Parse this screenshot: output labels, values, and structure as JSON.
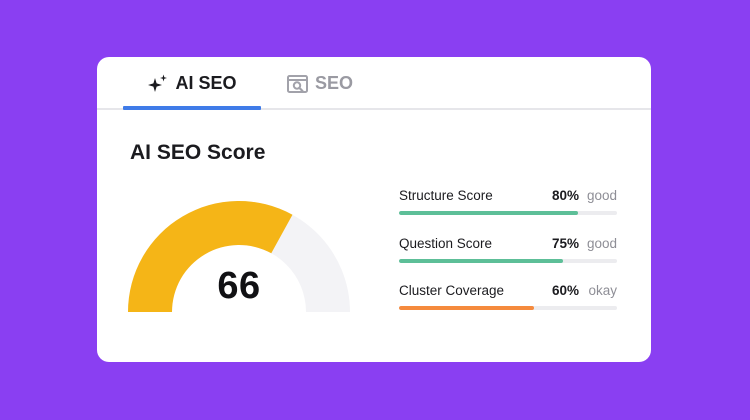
{
  "tabs": [
    {
      "label": "AI SEO",
      "icon": "sparkle-icon",
      "active": true,
      "accent": "#3f7be8"
    },
    {
      "label": "SEO",
      "icon": "seo-search-icon",
      "active": false
    }
  ],
  "main": {
    "title": "AI SEO Score",
    "gauge": {
      "value": "66",
      "fraction": 0.66,
      "fill_color": "#f5b517",
      "track_color": "#f3f3f6"
    },
    "metrics": [
      {
        "label": "Structure Score",
        "percent": "80%",
        "rating": "good",
        "fraction": 0.82,
        "color": "#5dbf98"
      },
      {
        "label": "Question Score",
        "percent": "75%",
        "rating": "good",
        "fraction": 0.75,
        "color": "#5dbf98"
      },
      {
        "label": "Cluster Coverage",
        "percent": "60%",
        "rating": "okay",
        "fraction": 0.62,
        "color": "#f58a3d"
      }
    ]
  }
}
